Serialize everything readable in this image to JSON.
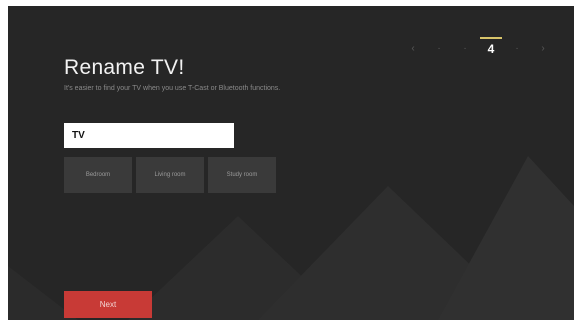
{
  "setup": {
    "steps": [
      "‹",
      "·",
      "·",
      "4",
      "·",
      "›"
    ],
    "active_step": "4"
  },
  "page": {
    "title": "Rename TV!",
    "subtitle": "It's easier to find your TV when you use T-Cast or Bluetooth functions."
  },
  "name_field": {
    "value": "TV"
  },
  "presets": [
    "Bedroom",
    "Living room",
    "Study room"
  ],
  "footer": {
    "next_label": "Next"
  },
  "colors": {
    "background": "#262626",
    "accent": "#c83a36",
    "step_indicator": "#d8c46a"
  }
}
